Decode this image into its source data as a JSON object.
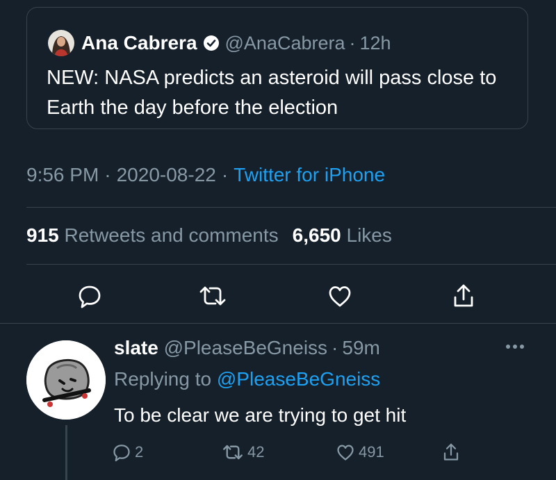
{
  "quoted_tweet": {
    "author_name": "Ana Cabrera",
    "handle": "@AnaCabrera",
    "separator": "·",
    "time": "12h",
    "text": "NEW: NASA predicts an asteroid will pass close to Earth the day before the election"
  },
  "tweet_meta": {
    "time": "9:56 PM",
    "date": "2020-08-22",
    "source": "Twitter for iPhone",
    "separator": "·"
  },
  "stats": {
    "retweets_count": "915",
    "retweets_label": "Retweets and comments",
    "likes_count": "6,650",
    "likes_label": "Likes"
  },
  "actions": {
    "icons": [
      "comment-icon",
      "retweet-icon",
      "like-icon",
      "share-icon"
    ]
  },
  "reply": {
    "author_name": "slate",
    "handle": "@PleaseBeGneiss",
    "separator": "·",
    "time": "59m",
    "replying_prefix": "Replying to",
    "replying_to": "@PleaseBeGneiss",
    "text": "To be clear we are trying to get hit",
    "comments": "2",
    "retweets": "42",
    "likes": "491"
  },
  "colors": {
    "background": "#15202b",
    "text_primary": "#ffffff",
    "text_secondary": "#8899a6",
    "accent": "#1da1f2",
    "border": "#38444d"
  }
}
